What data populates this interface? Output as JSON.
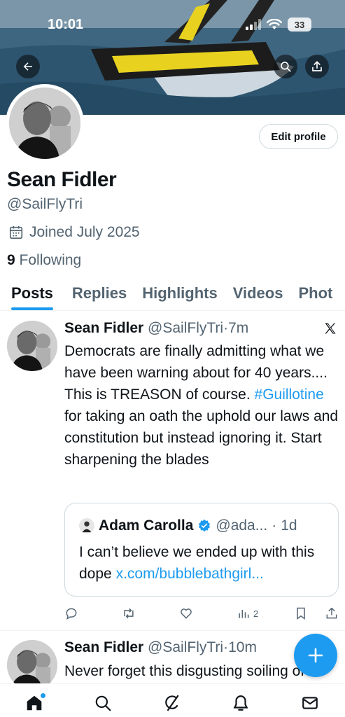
{
  "status_bar": {
    "time": "10:01",
    "battery": "33"
  },
  "profile": {
    "display_name": "Sean Fidler",
    "handle": "@SailFlyTri",
    "joined": "Joined July 2025",
    "following_count": "9",
    "following_label": "Following",
    "edit_button": "Edit profile"
  },
  "tabs": [
    "Posts",
    "Replies",
    "Highlights",
    "Videos",
    "Phot"
  ],
  "posts": [
    {
      "name": "Sean Fidler",
      "handle": "@SailFlyTri",
      "time": "7m",
      "text_before": "Democrats are finally admitting what we have been warning about for 40 years.... This is TREASON of course. ",
      "hashtag": "#Guillotine",
      "text_after": " for taking an oath the uphold our laws and constitution but instead ignoring it.  Start sharpening the blades",
      "quote": {
        "name": "Adam Carolla",
        "handle": "@ada...",
        "time": "1d",
        "text": "I can’t believe we ended up with this dope ",
        "link": "x.com/bubblebathgirl..."
      },
      "views": "2"
    },
    {
      "name": "Sean Fidler",
      "handle": "@SailFlyTri",
      "time": "10m",
      "text": "Never forget this disgusting soiling of"
    }
  ],
  "colors": {
    "accent": "#1d9bf0",
    "text": "#0f1419",
    "muted": "#536471"
  }
}
